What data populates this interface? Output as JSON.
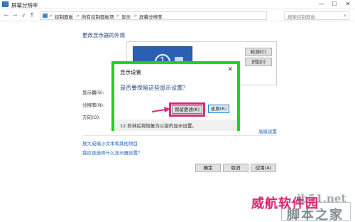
{
  "window": {
    "title": "屏幕分辨率",
    "minimize": "—",
    "maximize": "☐",
    "close": "✕"
  },
  "address_bar": {
    "back": "←",
    "forward": "→",
    "dropdown": "∨",
    "up": "↑",
    "breadcrumbs": [
      "控制面板",
      "所有控制面板项",
      "显示",
      "屏幕分辨率"
    ],
    "separator": ">",
    "search_placeholder": "搜索控制面板",
    "search_icon": "⌕"
  },
  "main": {
    "heading": "更改显示器的外观",
    "monitor_number": "1",
    "detect_button": "检测(C)",
    "identify_button": "识别(I)",
    "display_label": "显示器(S):",
    "resolution_label": "分辨率(R):",
    "orientation_label": "方向(O):",
    "advanced_link": "高级设置",
    "links": [
      "放大或缩小文本和其他项目",
      "我应该选择什么显示器设置？"
    ]
  },
  "buttons": {
    "ok": "确定",
    "cancel": "取消",
    "apply": "应用(A)"
  },
  "dialog": {
    "title": "显示设置",
    "close": "✕",
    "question": "是否要保留这些显示设置？",
    "keep_button": "保留更改(K)",
    "revert_button": "还原(R)",
    "countdown": "12 秒钟后将恢复为以前的显示设置。",
    "frame_color": "#22cc22",
    "highlight_color": "#d6247a"
  },
  "watermark": {
    "en": "jb51.net",
    "cn1": "威航软件园",
    "cn2": "脚本之家"
  }
}
